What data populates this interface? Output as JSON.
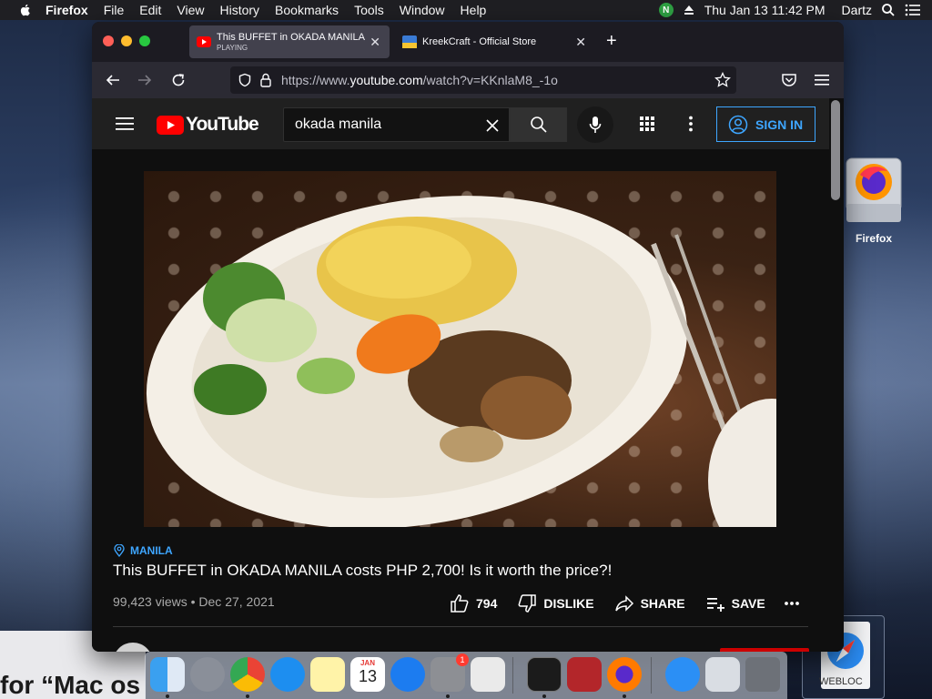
{
  "menubar": {
    "app": "Firefox",
    "items": [
      "File",
      "Edit",
      "View",
      "History",
      "Bookmarks",
      "Tools",
      "Window",
      "Help"
    ],
    "badge": "N",
    "datetime": "Thu Jan 13  11:42 PM",
    "user": "Dartz"
  },
  "browser": {
    "tabs": [
      {
        "title": "This BUFFET in OKADA MANILA",
        "status": "PLAYING"
      },
      {
        "title": "KreekCraft - Official Store"
      }
    ],
    "url_prefix": "https://www.",
    "url_domain": "youtube.com",
    "url_path": "/watch?v=KKnlaM8_-1o"
  },
  "youtube": {
    "logo_text": "YouTube",
    "search_value": "okada manila",
    "sign_in_label": "SIGN IN",
    "location": "MANILA",
    "video_title": "This BUFFET in OKADA MANILA costs PHP 2,700! Is it worth the price?!",
    "views": "99,423 views",
    "date": "Dec 27, 2021",
    "likes": "794",
    "dislike_label": "DISLIKE",
    "share_label": "SHARE",
    "save_label": "SAVE",
    "brand_color": "#ff0000",
    "link_color": "#3ea6ff"
  },
  "desktop": {
    "icon_label": "Firefox",
    "webloc_label": "WEBLOC",
    "bottom_text": "for “Mac os"
  },
  "dock": {
    "calendar_month": "JAN",
    "calendar_day": "13",
    "settings_badge": "1"
  }
}
